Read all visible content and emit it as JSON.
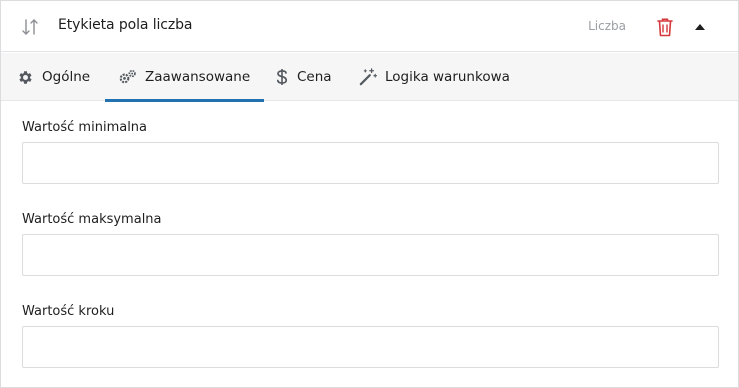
{
  "header": {
    "field_label": "Etykieta pola liczba",
    "field_type": "Liczba"
  },
  "tabs": [
    {
      "label": "Ogólne",
      "icon": "gear-icon"
    },
    {
      "label": "Zaawansowane",
      "icon": "gears-icon",
      "active": true
    },
    {
      "label": "Cena",
      "icon": "dollar-icon"
    },
    {
      "label": "Logika warunkowa",
      "icon": "magic-wand-icon"
    }
  ],
  "form": {
    "min": {
      "label": "Wartość minimalna",
      "value": ""
    },
    "max": {
      "label": "Wartość maksymalna",
      "value": ""
    },
    "step": {
      "label": "Wartość kroku",
      "value": ""
    }
  },
  "colors": {
    "accent": "#2271b1",
    "danger": "#d63638",
    "muted": "#9a9ea3"
  }
}
